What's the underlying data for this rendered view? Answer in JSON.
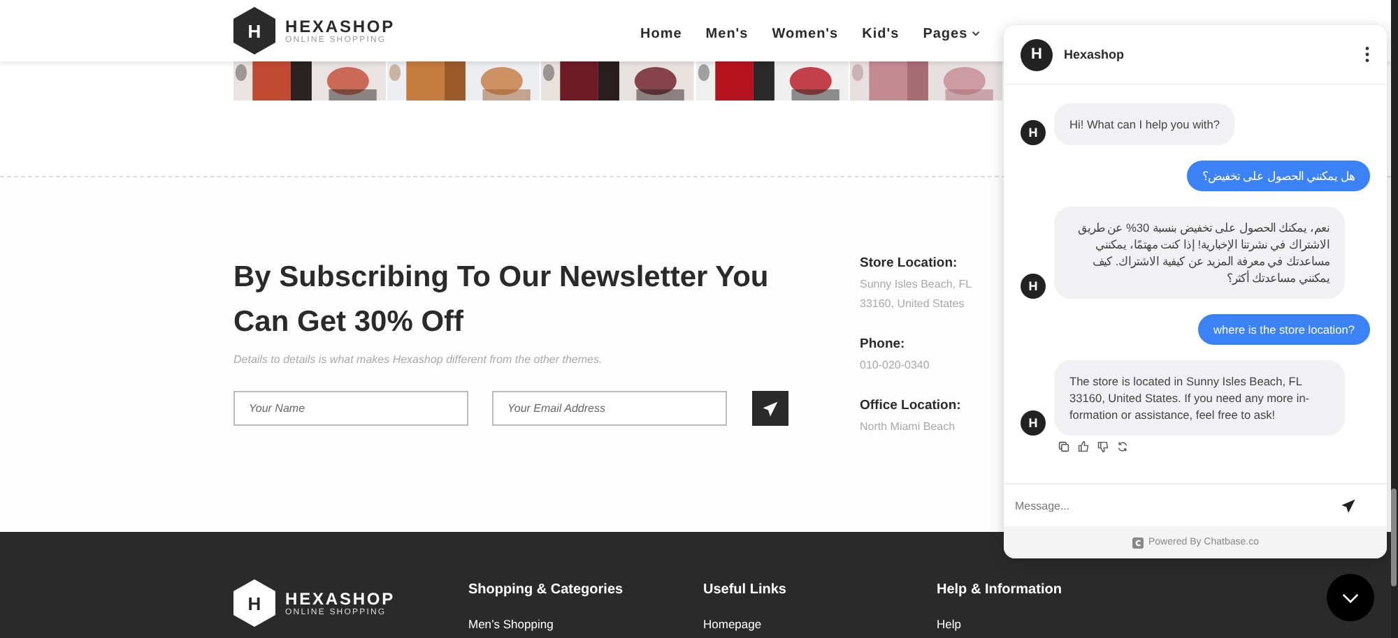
{
  "header": {
    "logo": {
      "mark": "H",
      "name": "HEXASHOP",
      "tagline": "ONLINE SHOPPING"
    },
    "nav": [
      {
        "label": "Home",
        "dropdown": false
      },
      {
        "label": "Men's",
        "dropdown": false
      },
      {
        "label": "Women's",
        "dropdown": false
      },
      {
        "label": "Kid's",
        "dropdown": false
      },
      {
        "label": "Pages",
        "dropdown": true
      }
    ]
  },
  "newsletter": {
    "title": "By Subscribing To Our Newsletter You Can Get 30% Off",
    "subtitle": "Details to details is what makes Hexashop different from the other themes.",
    "name_field": {
      "placeholder": "Your Name"
    },
    "email_field": {
      "placeholder": "Your Email Address"
    }
  },
  "contact": [
    {
      "label": "Store Location:",
      "value": "Sunny Isles Beach, FL 33160, United States"
    },
    {
      "label": "Phone:",
      "value": "010-020-0340"
    },
    {
      "label": "Office Location:",
      "value": "North Miami Beach"
    }
  ],
  "footer": {
    "logo": {
      "mark": "H",
      "name": "HEXASHOP",
      "tagline": "ONLINE SHOPPING"
    },
    "columns": [
      {
        "title": "Shopping & Categories",
        "links": [
          "Men’s Shopping"
        ]
      },
      {
        "title": "Useful Links",
        "links": [
          "Homepage"
        ]
      },
      {
        "title": "Help & Information",
        "links": [
          "Help"
        ]
      }
    ]
  },
  "chat": {
    "avatar": "H",
    "title": "Hexashop",
    "messages": [
      {
        "kind": "bot",
        "avatar": "H",
        "text": "Hi! What can I help you with?"
      },
      {
        "kind": "user",
        "text": "هل يمكنني الحصول على تخفيض؟"
      },
      {
        "kind": "bot",
        "avatar": "H",
        "text": "نعم، يمكنك الحصول على تخفيض بنسبة 30% عن طريق الاشتراك في نشرتنا الإخبارية! إذا كنت مهتمًا، يمكنني مساعدتك في معرفة المزيد عن كيفية الاشتراك. كيف يمكنني مساعدتك أكثر؟"
      },
      {
        "kind": "user",
        "text": "where is the store location?"
      },
      {
        "kind": "bot",
        "avatar": "H",
        "text": "The store is located in Sunny Isles Beach, FL 33160, United States. If you need any more in-formation or assistance, feel free to ask!"
      }
    ],
    "input": {
      "placeholder": "Message..."
    },
    "powered_by": "Powered By Chatbase.co"
  }
}
